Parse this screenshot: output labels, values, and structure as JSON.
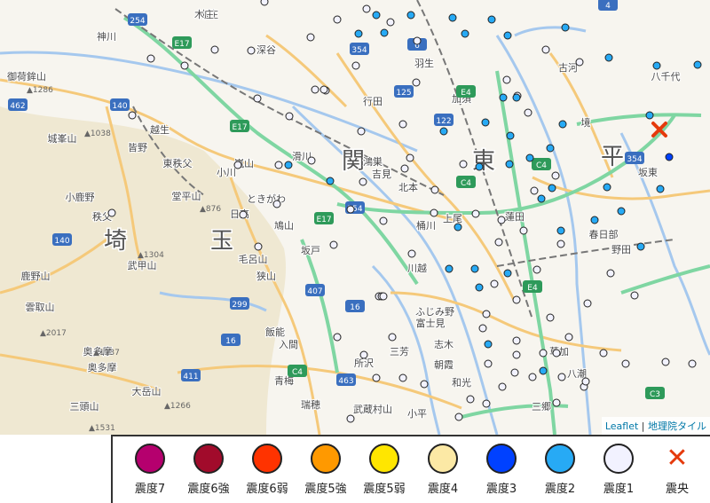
{
  "map": {
    "place_labels": [
      {
        "text": "関"
      },
      {
        "text": "東"
      },
      {
        "text": "平"
      },
      {
        "text": "玉"
      },
      {
        "text": "埼"
      },
      {
        "text": "東秩父"
      },
      {
        "text": "ときがわ"
      },
      {
        "text": "皆野"
      },
      {
        "text": "秩父"
      },
      {
        "text": "小鹿野"
      },
      {
        "text": "鳩山"
      },
      {
        "text": "毛呂山"
      },
      {
        "text": "坂戸"
      },
      {
        "text": "川越"
      },
      {
        "text": "ふじみ野"
      },
      {
        "text": "富士見"
      },
      {
        "text": "志木"
      },
      {
        "text": "所沢"
      },
      {
        "text": "入間"
      },
      {
        "text": "飯能"
      },
      {
        "text": "青梅"
      },
      {
        "text": "奥多摩"
      },
      {
        "text": "三郷"
      },
      {
        "text": "草加"
      },
      {
        "text": "八潮"
      },
      {
        "text": "上尾"
      },
      {
        "text": "桶川"
      },
      {
        "text": "蓮田"
      },
      {
        "text": "春日部"
      },
      {
        "text": "野田"
      },
      {
        "text": "坂東"
      },
      {
        "text": "境"
      },
      {
        "text": "古河"
      },
      {
        "text": "八千代"
      },
      {
        "text": "加須"
      },
      {
        "text": "行田"
      },
      {
        "text": "羽生"
      },
      {
        "text": "深谷"
      },
      {
        "text": "本庄"
      },
      {
        "text": "神川"
      },
      {
        "text": "吉見"
      },
      {
        "text": "北本"
      },
      {
        "text": "鴻巣"
      },
      {
        "text": "滑川"
      },
      {
        "text": "嵐山"
      },
      {
        "text": "小川"
      },
      {
        "text": "越生"
      },
      {
        "text": "日高"
      },
      {
        "text": "狭山"
      },
      {
        "text": "三芳"
      },
      {
        "text": "朝霞"
      },
      {
        "text": "和光"
      },
      {
        "text": "武蔵村山"
      },
      {
        "text": "小平"
      },
      {
        "text": "瑞穂"
      },
      {
        "text": "鹿野山"
      },
      {
        "text": "奥多摩"
      },
      {
        "text": "三頭山"
      },
      {
        "text": "大岳山"
      },
      {
        "text": "雲取山"
      },
      {
        "text": "御荷鉾山"
      },
      {
        "text": "城峯山"
      },
      {
        "text": "武甲山"
      },
      {
        "text": "堂平山"
      },
      {
        "text": "木庄"
      }
    ],
    "elevations": [
      "1286",
      "1038",
      "876",
      "1304",
      "2017",
      "1737",
      "1266",
      "1531"
    ],
    "road_shields": [
      "E17",
      "E17",
      "E17",
      "E4",
      "E4",
      "C4",
      "C4",
      "C3",
      "C4",
      "254",
      "254",
      "299",
      "407",
      "16",
      "16",
      "140",
      "140",
      "462",
      "411",
      "463",
      "354",
      "354",
      "125",
      "122",
      "4",
      "6"
    ],
    "attribution": {
      "leaflet": "Leaflet",
      "separator": " | ",
      "gsi": "地理院タイル"
    }
  },
  "stations": [
    {
      "int": "1"
    },
    {
      "int": "1"
    },
    {
      "int": "1"
    },
    {
      "int": "1"
    },
    {
      "int": "1"
    },
    {
      "int": "1"
    },
    {
      "int": "1"
    },
    {
      "int": "1"
    },
    {
      "int": "1"
    },
    {
      "int": "1"
    },
    {
      "int": "1"
    },
    {
      "int": "1"
    },
    {
      "int": "1"
    },
    {
      "int": "1"
    },
    {
      "int": "1"
    },
    {
      "int": "1"
    },
    {
      "int": "1"
    },
    {
      "int": "1"
    },
    {
      "int": "1"
    },
    {
      "int": "1"
    },
    {
      "int": "1"
    },
    {
      "int": "1"
    },
    {
      "int": "1"
    },
    {
      "int": "1"
    },
    {
      "int": "1"
    },
    {
      "int": "1"
    },
    {
      "int": "1"
    },
    {
      "int": "1"
    },
    {
      "int": "1"
    },
    {
      "int": "1"
    },
    {
      "int": "1"
    },
    {
      "int": "1"
    },
    {
      "int": "1"
    },
    {
      "int": "1"
    },
    {
      "int": "1"
    },
    {
      "int": "1"
    },
    {
      "int": "1"
    },
    {
      "int": "1"
    },
    {
      "int": "1"
    },
    {
      "int": "1"
    },
    {
      "int": "1"
    },
    {
      "int": "1"
    },
    {
      "int": "1"
    },
    {
      "int": "1"
    },
    {
      "int": "1"
    },
    {
      "int": "1"
    },
    {
      "int": "1"
    },
    {
      "int": "1"
    },
    {
      "int": "1"
    },
    {
      "int": "1"
    },
    {
      "int": "1"
    },
    {
      "int": "1"
    },
    {
      "int": "1"
    },
    {
      "int": "1"
    },
    {
      "int": "1"
    },
    {
      "int": "1"
    },
    {
      "int": "1"
    },
    {
      "int": "1"
    },
    {
      "int": "1"
    },
    {
      "int": "1"
    },
    {
      "int": "1"
    },
    {
      "int": "1"
    },
    {
      "int": "1"
    },
    {
      "int": "1"
    },
    {
      "int": "1"
    },
    {
      "int": "1"
    },
    {
      "int": "1"
    },
    {
      "int": "1"
    },
    {
      "int": "1"
    },
    {
      "int": "1"
    },
    {
      "int": "1"
    },
    {
      "int": "1"
    },
    {
      "int": "1"
    },
    {
      "int": "1"
    },
    {
      "int": "1"
    },
    {
      "int": "1"
    },
    {
      "int": "1"
    },
    {
      "int": "1"
    },
    {
      "int": "1"
    },
    {
      "int": "1"
    },
    {
      "int": "1"
    },
    {
      "int": "1"
    },
    {
      "int": "1"
    },
    {
      "int": "1"
    },
    {
      "int": "1"
    },
    {
      "int": "1"
    },
    {
      "int": "1"
    },
    {
      "int": "1"
    },
    {
      "int": "2"
    },
    {
      "int": "2"
    },
    {
      "int": "2"
    },
    {
      "int": "2"
    },
    {
      "int": "2"
    },
    {
      "int": "2"
    },
    {
      "int": "2"
    },
    {
      "int": "2"
    },
    {
      "int": "2"
    },
    {
      "int": "2"
    },
    {
      "int": "2"
    },
    {
      "int": "2"
    },
    {
      "int": "2"
    },
    {
      "int": "2"
    },
    {
      "int": "2"
    },
    {
      "int": "2"
    },
    {
      "int": "2"
    },
    {
      "int": "2"
    },
    {
      "int": "2"
    },
    {
      "int": "2"
    },
    {
      "int": "2"
    },
    {
      "int": "2"
    },
    {
      "int": "2"
    },
    {
      "int": "2"
    },
    {
      "int": "2"
    },
    {
      "int": "2"
    },
    {
      "int": "2"
    },
    {
      "int": "2"
    },
    {
      "int": "2"
    },
    {
      "int": "2"
    },
    {
      "int": "2"
    },
    {
      "int": "2"
    },
    {
      "int": "2"
    },
    {
      "int": "2"
    },
    {
      "int": "2"
    },
    {
      "int": "2"
    },
    {
      "int": "2"
    },
    {
      "int": "2"
    },
    {
      "int": "2"
    },
    {
      "int": "2"
    },
    {
      "int": "3"
    }
  ],
  "epicenter": {
    "label": "震央"
  },
  "legend": [
    {
      "label": "震度7",
      "color": "#b5006e"
    },
    {
      "label": "震度6強",
      "color": "#a10b2b"
    },
    {
      "label": "震度6弱",
      "color": "#ff3300"
    },
    {
      "label": "震度5強",
      "color": "#ff9900"
    },
    {
      "label": "震度5弱",
      "color": "#ffe600"
    },
    {
      "label": "震度4",
      "color": "#fce9a5"
    },
    {
      "label": "震度3",
      "color": "#0041ff"
    },
    {
      "label": "震度2",
      "color": "#27aaf5"
    },
    {
      "label": "震度1",
      "color": "#f2f2ff"
    },
    {
      "label": "震央",
      "color": "#e53a0c",
      "marker": "cross"
    }
  ],
  "colors": {
    "intensity_1": "#f2f2ff",
    "intensity_2": "#27aaf5",
    "intensity_3": "#0041ff",
    "epicenter": "#e53a0c"
  }
}
